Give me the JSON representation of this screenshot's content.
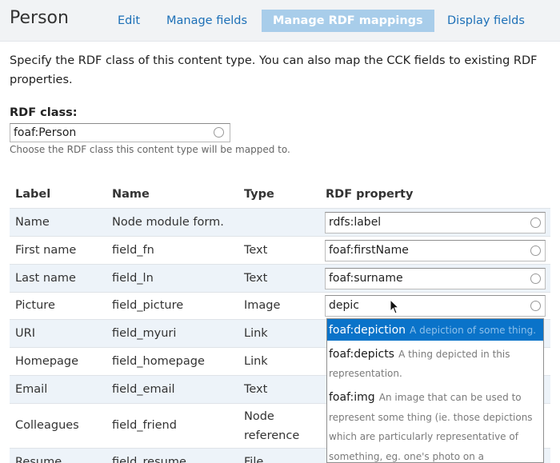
{
  "header": {
    "title": "Person",
    "tabs": [
      {
        "label": "Edit"
      },
      {
        "label": "Manage fields"
      },
      {
        "label": "Manage RDF mappings"
      },
      {
        "label": "Display fields"
      }
    ]
  },
  "intro": "Specify the RDF class of this content type. You can also map the CCK fields to existing RDF properties.",
  "rdf_class": {
    "label": "RDF class:",
    "value": "foaf:Person",
    "help": "Choose the RDF class this content type will be mapped to."
  },
  "table": {
    "headers": [
      "Label",
      "Name",
      "Type",
      "RDF property"
    ],
    "rows": [
      {
        "label": "Name",
        "name": "Node module form.",
        "type": "",
        "property": "rdfs:label"
      },
      {
        "label": "First name",
        "name": "field_fn",
        "type": "Text",
        "property": "foaf:firstName"
      },
      {
        "label": "Last name",
        "name": "field_ln",
        "type": "Text",
        "property": "foaf:surname"
      },
      {
        "label": "Picture",
        "name": "field_picture",
        "type": "Image",
        "property": "depic"
      },
      {
        "label": "URI",
        "name": "field_myuri",
        "type": "Link",
        "property": ""
      },
      {
        "label": "Homepage",
        "name": "field_homepage",
        "type": "Link",
        "property": ""
      },
      {
        "label": "Email",
        "name": "field_email",
        "type": "Text",
        "property": ""
      },
      {
        "label": "Colleagues",
        "name": "field_friend",
        "type_line1": "Node",
        "type_line2": "reference",
        "property": ""
      },
      {
        "label": "Resume",
        "name": "field_resume",
        "type": "File",
        "property": ""
      }
    ]
  },
  "autocomplete": [
    {
      "key": "foaf:depiction",
      "desc": "A depiction of some thing."
    },
    {
      "key": "foaf:depicts",
      "desc_line1": "A thing depicted in this",
      "desc_line2": "representation."
    },
    {
      "key": "foaf:img",
      "desc_line1": "An image that can be used to",
      "desc_line2": "represent some thing (ie. those depictions",
      "desc_line3": "which are particularly representative of",
      "desc_line4": "something, eg. one's photo on a"
    }
  ]
}
